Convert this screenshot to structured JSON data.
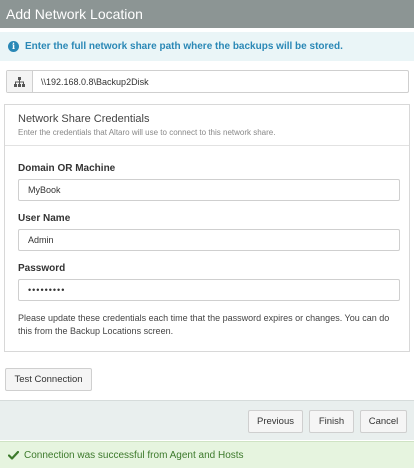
{
  "dialog": {
    "title": "Add Network Location"
  },
  "info": {
    "icon": "info-icon",
    "text": "Enter the full network share path where the backups will be stored."
  },
  "share_path": {
    "icon": "network-icon",
    "value": "\\\\192.168.0.8\\Backup2Disk"
  },
  "credentials": {
    "title": "Network Share Credentials",
    "subtitle": "Enter the credentials that Altaro will use to connect to this network share.",
    "domain_label": "Domain OR Machine",
    "domain_value": "MyBook",
    "username_label": "User Name",
    "username_value": "Admin",
    "password_label": "Password",
    "password_value": "•••••••••",
    "note": "Please update these credentials each time that the password expires or changes. You can do this from the Backup Locations screen."
  },
  "actions": {
    "test_connection": "Test Connection",
    "previous": "Previous",
    "finish": "Finish",
    "cancel": "Cancel"
  },
  "status": {
    "icon": "check-icon",
    "text": "Connection was successful from Agent and Hosts",
    "color": "#3d7a2c"
  }
}
